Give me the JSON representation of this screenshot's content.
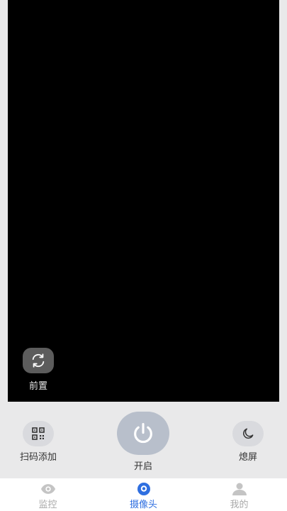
{
  "preview": {
    "flip_label": "前置"
  },
  "controls": {
    "scan_label": "扫码添加",
    "power_label": "开启",
    "screen_off_label": "熄屏"
  },
  "tabs": [
    {
      "label": "监控",
      "icon": "eye-icon",
      "active": false
    },
    {
      "label": "摄像头",
      "icon": "camera-icon",
      "active": true
    },
    {
      "label": "我的",
      "icon": "user-icon",
      "active": false
    }
  ],
  "colors": {
    "accent": "#2f6fe0",
    "inactive": "#a9a9a9",
    "power_button": "#b8bfcb"
  }
}
